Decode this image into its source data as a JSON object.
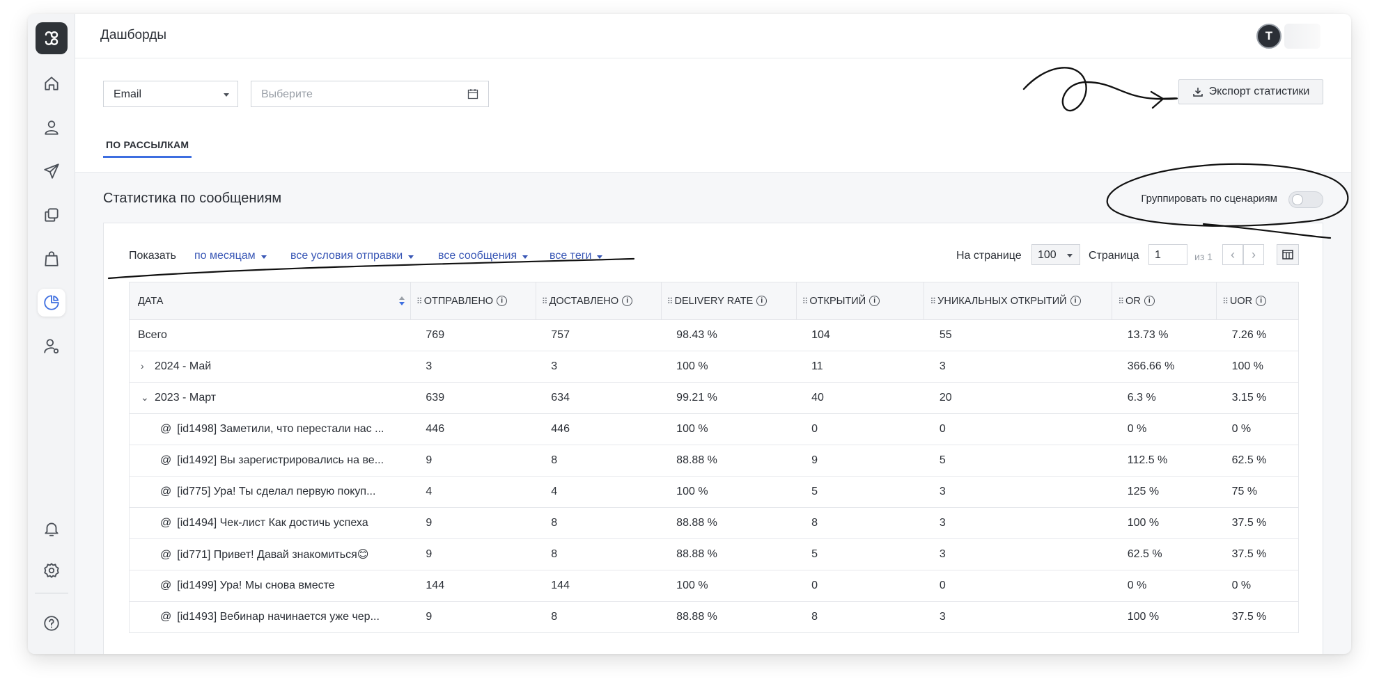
{
  "header": {
    "title": "Дашборды",
    "avatar_initial": "T"
  },
  "filters": {
    "channel": "Email",
    "date_placeholder": "Выберите",
    "export_label": "Экспорт статистики"
  },
  "tabs": [
    {
      "label": "ПО РАССЫЛКАМ"
    }
  ],
  "section": {
    "title": "Статистика по сообщениям",
    "group_toggle_label": "Группировать по сценариям"
  },
  "toolbar": {
    "show_label": "Показать",
    "filters": [
      "по месяцам",
      "все условия отправки",
      "все сообщения",
      "все теги"
    ],
    "per_page_label": "На странице",
    "per_page_value": "100",
    "page_label": "Страница",
    "page_value": "1",
    "page_of": "из 1"
  },
  "table": {
    "columns": [
      "ДАТА",
      "ОТПРАВЛЕНО",
      "ДОСТАВЛЕНО",
      "DELIVERY RATE",
      "ОТКРЫТИЙ",
      "УНИКАЛЬНЫХ ОТКРЫТИЙ",
      "OR",
      "UOR"
    ],
    "rows": [
      {
        "kind": "total",
        "label": "Всего",
        "cells": [
          "769",
          "757",
          "98.43 %",
          "104",
          "55",
          "13.73 %",
          "7.26 %"
        ]
      },
      {
        "kind": "group-collapsed",
        "label": "2024 - Май",
        "cells": [
          "3",
          "3",
          "100 %",
          "11",
          "3",
          "366.66 %",
          "100 %"
        ]
      },
      {
        "kind": "group-expanded",
        "label": "2023 - Март",
        "cells": [
          "639",
          "634",
          "99.21 %",
          "40",
          "20",
          "6.3 %",
          "3.15 %"
        ]
      },
      {
        "kind": "message",
        "label": "[id1498] Заметили, что перестали нас ...",
        "cells": [
          "446",
          "446",
          "100 %",
          "0",
          "0",
          "0 %",
          "0 %"
        ]
      },
      {
        "kind": "message",
        "label": "[id1492] Вы зарегистрировались на ве...",
        "cells": [
          "9",
          "8",
          "88.88 %",
          "9",
          "5",
          "112.5 %",
          "62.5 %"
        ]
      },
      {
        "kind": "message",
        "label": "[id775] Ура! Ты сделал первую покуп...",
        "cells": [
          "4",
          "4",
          "100 %",
          "5",
          "3",
          "125 %",
          "75 %"
        ]
      },
      {
        "kind": "message",
        "label": "[id1494] Чек-лист Как достичь успеха",
        "cells": [
          "9",
          "8",
          "88.88 %",
          "8",
          "3",
          "100 %",
          "37.5 %"
        ]
      },
      {
        "kind": "message",
        "label": "[id771] Привет! Давай знакомиться😊",
        "cells": [
          "9",
          "8",
          "88.88 %",
          "5",
          "3",
          "62.5 %",
          "37.5 %"
        ]
      },
      {
        "kind": "message",
        "label": "[id1499] Ура! Мы снова вместе",
        "cells": [
          "144",
          "144",
          "100 %",
          "0",
          "0",
          "0 %",
          "0 %"
        ]
      },
      {
        "kind": "message",
        "label": "[id1493] Вебинар начинается уже чер...",
        "cells": [
          "9",
          "8",
          "88.88 %",
          "8",
          "3",
          "100 %",
          "37.5 %"
        ]
      }
    ]
  },
  "icons": {
    "sidebar_top": [
      "home-icon",
      "user-icon",
      "send-icon",
      "copy-icon",
      "bag-icon",
      "pie-chart-icon",
      "user-settings-icon"
    ],
    "sidebar_bottom": [
      "bell-icon",
      "gear-icon",
      "help-icon"
    ]
  },
  "colors": {
    "accent": "#3d6ee0",
    "link": "#3856b5",
    "logo_bg": "#2f3338"
  },
  "toggle_on": false
}
